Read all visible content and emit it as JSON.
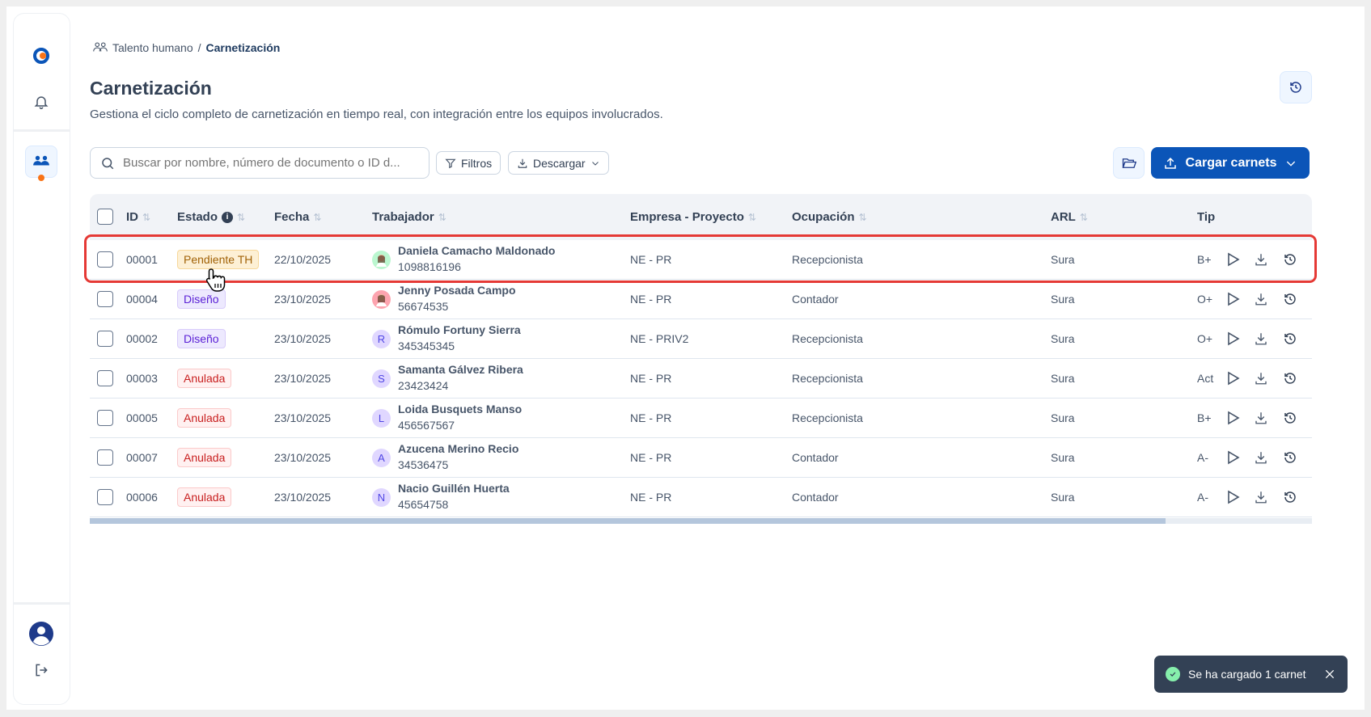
{
  "breadcrumb": {
    "parent": "Talento humano",
    "separator": "/",
    "current": "Carnetización"
  },
  "page": {
    "title": "Carnetización",
    "subtitle": "Gestiona el ciclo completo de carnetización en tiempo real, con integración entre los equipos involucrados."
  },
  "toolbar": {
    "search_placeholder": "Buscar por nombre, número de documento o ID d...",
    "filters_label": "Filtros",
    "download_label": "Descargar",
    "upload_label": "Cargar carnets"
  },
  "table": {
    "headers": {
      "id": "ID",
      "estado": "Estado",
      "fecha": "Fecha",
      "trabajador": "Trabajador",
      "empresa": "Empresa - Proyecto",
      "ocupacion": "Ocupación",
      "arl": "ARL",
      "tipo": "Tip"
    },
    "rows": [
      {
        "id": "00001",
        "estado": "Pendiente TH",
        "status": "pending",
        "fecha": "22/10/2025",
        "name": "Daniela Camacho Maldonado",
        "doc": "1098816196",
        "avatar": "photo",
        "empresa": "NE - PR",
        "ocupacion": "Recepcionista",
        "arl": "Sura",
        "tipo": "B+"
      },
      {
        "id": "00004",
        "estado": "Diseño",
        "status": "design",
        "fecha": "23/10/2025",
        "name": "Jenny Posada Campo",
        "doc": "56674535",
        "avatar": "photo",
        "empresa": "NE - PR",
        "ocupacion": "Contador",
        "arl": "Sura",
        "tipo": "O+"
      },
      {
        "id": "00002",
        "estado": "Diseño",
        "status": "design",
        "fecha": "23/10/2025",
        "name": "Rómulo Fortuny Sierra",
        "doc": "345345345",
        "avatar": "R",
        "empresa": "NE - PRIV2",
        "ocupacion": "Recepcionista",
        "arl": "Sura",
        "tipo": "O+"
      },
      {
        "id": "00003",
        "estado": "Anulada",
        "status": "void",
        "fecha": "23/10/2025",
        "name": "Samanta Gálvez Ribera",
        "doc": "23423424",
        "avatar": "S",
        "empresa": "NE - PR",
        "ocupacion": "Recepcionista",
        "arl": "Sura",
        "tipo": "Act"
      },
      {
        "id": "00005",
        "estado": "Anulada",
        "status": "void",
        "fecha": "23/10/2025",
        "name": "Loida Busquets Manso",
        "doc": "456567567",
        "avatar": "L",
        "empresa": "NE - PR",
        "ocupacion": "Recepcionista",
        "arl": "Sura",
        "tipo": "B+"
      },
      {
        "id": "00007",
        "estado": "Anulada",
        "status": "void",
        "fecha": "23/10/2025",
        "name": "Azucena Merino Recio",
        "doc": "34536475",
        "avatar": "A",
        "empresa": "NE - PR",
        "ocupacion": "Contador",
        "arl": "Sura",
        "tipo": "A-"
      },
      {
        "id": "00006",
        "estado": "Anulada",
        "status": "void",
        "fecha": "23/10/2025",
        "name": "Nacio Guillén Huerta",
        "doc": "45654758",
        "avatar": "N",
        "empresa": "NE - PR",
        "ocupacion": "Contador",
        "arl": "Sura",
        "tipo": "A-"
      }
    ],
    "horizontal_scroll_fraction": 0.88
  },
  "toast": {
    "message": "Se ha cargado 1 carnet",
    "type": "success"
  },
  "colors": {
    "primary": "#0b55b8",
    "pending_bg": "#fdf0d5",
    "pending_fg": "#a16207",
    "design_bg": "#ede9fe",
    "design_fg": "#5b21d6",
    "void_bg": "#fff1f1",
    "void_fg": "#c81e1e",
    "highlight": "#e53935",
    "notification_dot": "#f97316"
  }
}
